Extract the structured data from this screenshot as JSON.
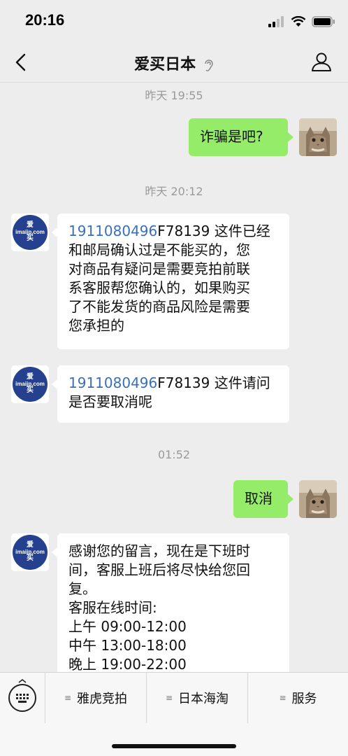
{
  "status_bar": {
    "time": "20:16"
  },
  "nav": {
    "title": "爱买日本"
  },
  "shop_avatar": {
    "line1": "爱",
    "line2": "imaijp.com",
    "line3": "买"
  },
  "messages": {
    "ts1": "昨天 19:55",
    "m1": "诈骗是吧?",
    "ts2": "昨天 20:12",
    "m2": {
      "link": "1911080496",
      "lines": [
        "F78139 这件已经",
        "和邮局确认过是不能买的，您",
        "对商品有疑问是需要竞拍前联",
        "系客服帮您确认的，如果购买",
        "了不能发货的商品风险是需要",
        "您承担的"
      ]
    },
    "m3": {
      "link": "1911080496",
      "lines": [
        "F78139 这件请问",
        "是否要取消呢"
      ]
    },
    "ts3": "01:52",
    "m4": "取消",
    "m5": {
      "lines": [
        "感谢您的留言，现在是下班时",
        "间，客服上班后将尽快给您回",
        "复。",
        "客服在线时间:",
        "上午 09:00-12:00",
        "中午 13:00-18:00",
        "晚上 19:00-22:00"
      ]
    }
  },
  "bottom_menu": {
    "items": [
      "雅虎竞拍",
      "日本海淘",
      "服务"
    ]
  },
  "colors": {
    "outgoing_bubble": "#95ec69",
    "incoming_bubble": "#ffffff",
    "link": "#3a6fb8",
    "shop_brand": "#24408e"
  }
}
